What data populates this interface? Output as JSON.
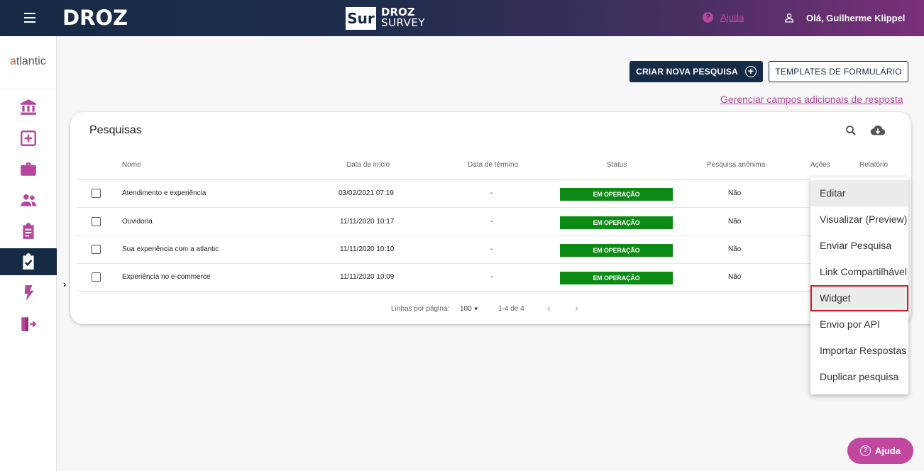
{
  "header": {
    "brand": "DROZ",
    "product_badge": "Sur",
    "product_line1": "DROZ",
    "product_line2": "SURVEY",
    "help_link": "Ajuda",
    "greeting": "Olá, Guilherme Klippel"
  },
  "sidebar": {
    "client_brand_initial": "a",
    "client_brand_rest": "tlantic",
    "items": [
      {
        "name": "bank-icon",
        "active": false
      },
      {
        "name": "add-box-icon",
        "active": false
      },
      {
        "name": "briefcase-icon",
        "active": false
      },
      {
        "name": "people-icon",
        "active": false
      },
      {
        "name": "clipboard-icon",
        "active": false
      },
      {
        "name": "clipboard-check-icon",
        "active": true
      },
      {
        "name": "lightning-icon",
        "active": false
      },
      {
        "name": "exit-door-icon",
        "active": false
      }
    ]
  },
  "actions": {
    "create_label": "CRIAR NOVA PESQUISA",
    "templates_label": "TEMPLATES DE FORMULÁRIO",
    "manage_link": "Gerenciar campos adicionais de resposta"
  },
  "table": {
    "title": "Pesquisas",
    "columns": {
      "name": "Nome",
      "start": "Data de início",
      "end": "Data de término",
      "status": "Status",
      "anonymous": "Pesquisa anônima",
      "actions": "Ações",
      "report": "Relatório"
    },
    "rows": [
      {
        "name": "Atendimento e experiência",
        "start": "03/02/2021 07:19",
        "end": "-",
        "status": "EM OPERAÇÃO",
        "anonymous": "Não"
      },
      {
        "name": "Ouvidoria",
        "start": "11/11/2020 10:17",
        "end": "-",
        "status": "EM OPERAÇÃO",
        "anonymous": "Não"
      },
      {
        "name": "Sua experiência com a atlantic",
        "start": "11/11/2020 10:10",
        "end": "-",
        "status": "EM OPERAÇÃO",
        "anonymous": "Não"
      },
      {
        "name": "Experiência no e-commerce",
        "start": "11/11/2020 10:09",
        "end": "-",
        "status": "EM OPERAÇÃO",
        "anonymous": "Não"
      }
    ],
    "pagination": {
      "rows_per_page_label": "Linhas por página:",
      "rows_per_page_value": "100",
      "range": "1-4 de 4"
    }
  },
  "menu": {
    "items": [
      "Editar",
      "Visualizar (Preview)",
      "Enviar Pesquisa",
      "Link Compartilhável",
      "Widget",
      "Envio por API",
      "Importar Respostas",
      "Duplicar pesquisa"
    ],
    "hovered_index": 0,
    "highlighted_index": 4
  },
  "help_fab": "Ajuda",
  "colors": {
    "navy": "#152a45",
    "accent_pink": "#c2479e",
    "status_green": "#0b8a14",
    "highlight_red": "#e01b1b"
  }
}
